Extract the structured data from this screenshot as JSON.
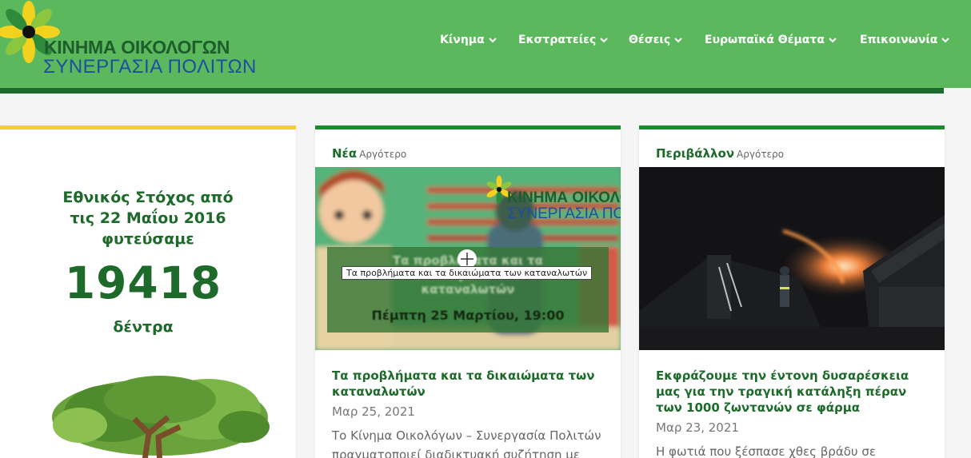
{
  "header": {
    "logo": {
      "line1": "ΚΙΝΗΜΑ ΟΙΚΟΛΟΓΩΝ",
      "line2": "ΣΥΝΕΡΓΑΣΙΑ ΠΟΛΙΤΩΝ"
    },
    "nav": [
      {
        "label": "Κίνημα"
      },
      {
        "label": "Εκστρατείες"
      },
      {
        "label": "Θέσεις"
      },
      {
        "label": "Ευρωπαϊκά Θέματα"
      },
      {
        "label": "Επικοινωνία"
      }
    ]
  },
  "goal_widget": {
    "text": "Εθνικός Στόχος από τις 22 Μαΐου 2016 φυτεύσαμε",
    "number": "19418",
    "unit": "δέντρα"
  },
  "cards": [
    {
      "category": "Νέα",
      "more": "Αργότερο",
      "image": {
        "logo_line1": "ΚΙΝΗΜΑ ΟΙΚΟΛΟΓΩΝ",
        "logo_line2": "ΣΥΝΕΡΓΑΣΙΑ ΠΟΛΙΤΩΝ",
        "overlay_title": "Τα προβλήματα και τα δικαιώματα των καταναλωτών",
        "overlay_date": "Πέμπτη 25 Μαρτίου, 19:00",
        "tooltip": "Τα προβλήματα και τα δικαιώματα των καταναλωτών"
      },
      "title": "Τα προβλήματα και τα δικαιώματα των καταναλωτών",
      "date": "Μαρ 25, 2021",
      "excerpt": "Το Κίνημα Οικολόγων – Συνεργασία Πολιτών πραγματοποιεί διαδικτυακή συζήτηση με"
    },
    {
      "category": "Περιβάλλον",
      "more": "Αργότερο",
      "title": "Εκφράζουμε την έντονη δυσαρέσκεια μας για την τραγική κατάληξη πέραν των 1000 ζωντανών σε φάρμα",
      "date": "Μαρ 23, 2021",
      "excerpt": "Η φωτιά που ξέσπασε χθες βράδυ σε"
    }
  ],
  "colors": {
    "header_bg": "#5cb85c",
    "header_line": "#1e6b2e",
    "brand_green": "#1d6a2b",
    "brand_blue": "#1d4fa0",
    "accent_yellow": "#f2d21c",
    "card_top": "#1d8a2e"
  },
  "icons": [
    "sunflower-logo-icon",
    "chevron-down-icon",
    "plus-icon",
    "tree-illustration"
  ]
}
